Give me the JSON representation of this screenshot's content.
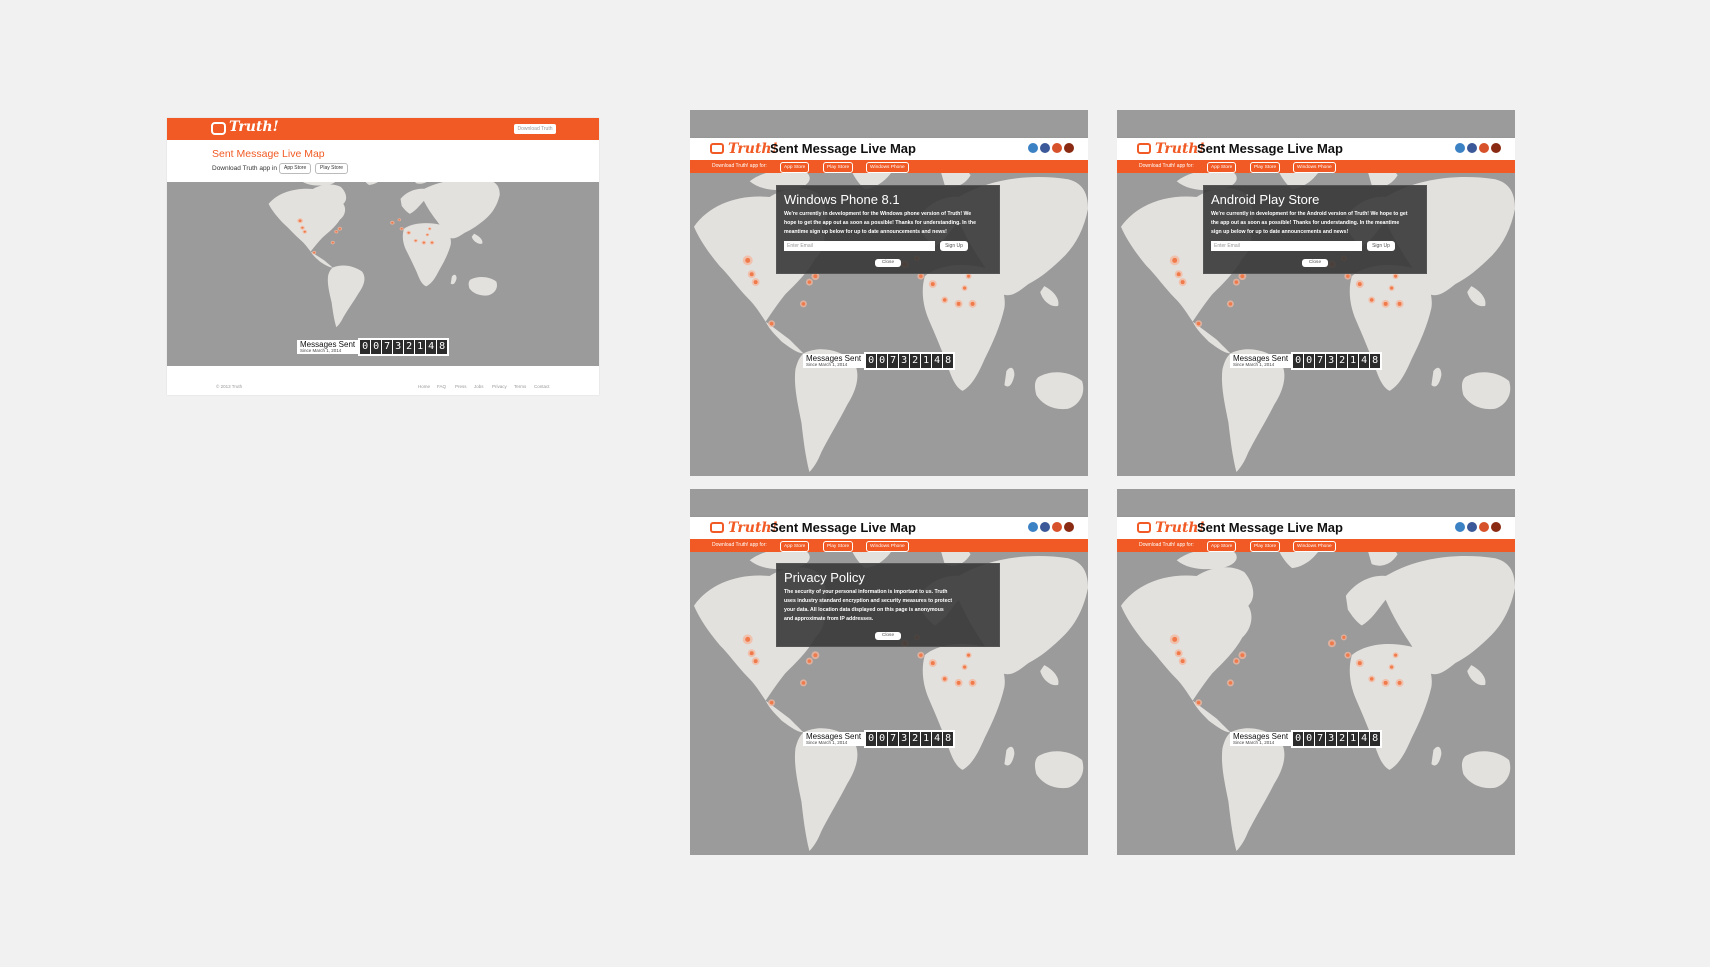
{
  "desktop": {
    "logo": "Truth!",
    "download_button": "Download Truth",
    "title": "Sent Message Live Map",
    "subtitle": "Download Truth app in",
    "stores": [
      "App Store",
      "Play Store"
    ],
    "counter_label": "Messages Sent",
    "counter_since": "Since March 1, 2014",
    "digits": [
      "0",
      "0",
      "7",
      "3",
      "2",
      "1",
      "4",
      "8"
    ],
    "copyright": "© 2013 Truth",
    "footer_links": [
      "Home",
      "FAQ",
      "Press",
      "Jobs",
      "Privacy",
      "Terms",
      "Contact"
    ]
  },
  "mobile": {
    "logo": "Truth!",
    "title": "Sent Message Live Map",
    "download_text": "Download Truth! app for:",
    "stores": [
      "App Store",
      "Play Store",
      "Windows Phone"
    ],
    "counter_label": "Messages Sent",
    "counter_since": "Since March 1, 2014",
    "digits": [
      "0",
      "0",
      "7",
      "3",
      "2",
      "1",
      "4",
      "8"
    ],
    "social_colors": [
      "#3b82c4",
      "#3b5998",
      "#d7522a",
      "#8a2a12"
    ]
  },
  "modals": {
    "windows": {
      "heading": "Windows Phone 8.1",
      "body": "We're currently in development for the Windows phone version of Truth! We hope to get the app out as soon as possible! Thanks for understanding. In the meantime sign up below for up to date announcements and news!",
      "email_placeholder": "Enter Email",
      "signup": "Sign Up",
      "close": "Close"
    },
    "android": {
      "heading": "Android Play Store",
      "body": "We're currently in development for the Android version of Truth! We hope to get the app out as soon as possible! Thanks for understanding. In the meantime sign up below for up to date announcements and news!",
      "email_placeholder": "Enter Email",
      "signup": "Sign Up",
      "close": "Close"
    },
    "privacy": {
      "heading": "Privacy Policy",
      "body": "The security of your personal information is important to us. Truth uses industry standard encryption and security measures to protect your data. All location data displayed on this page is anonymous and approximate from IP addresses.",
      "close": "Close"
    }
  }
}
